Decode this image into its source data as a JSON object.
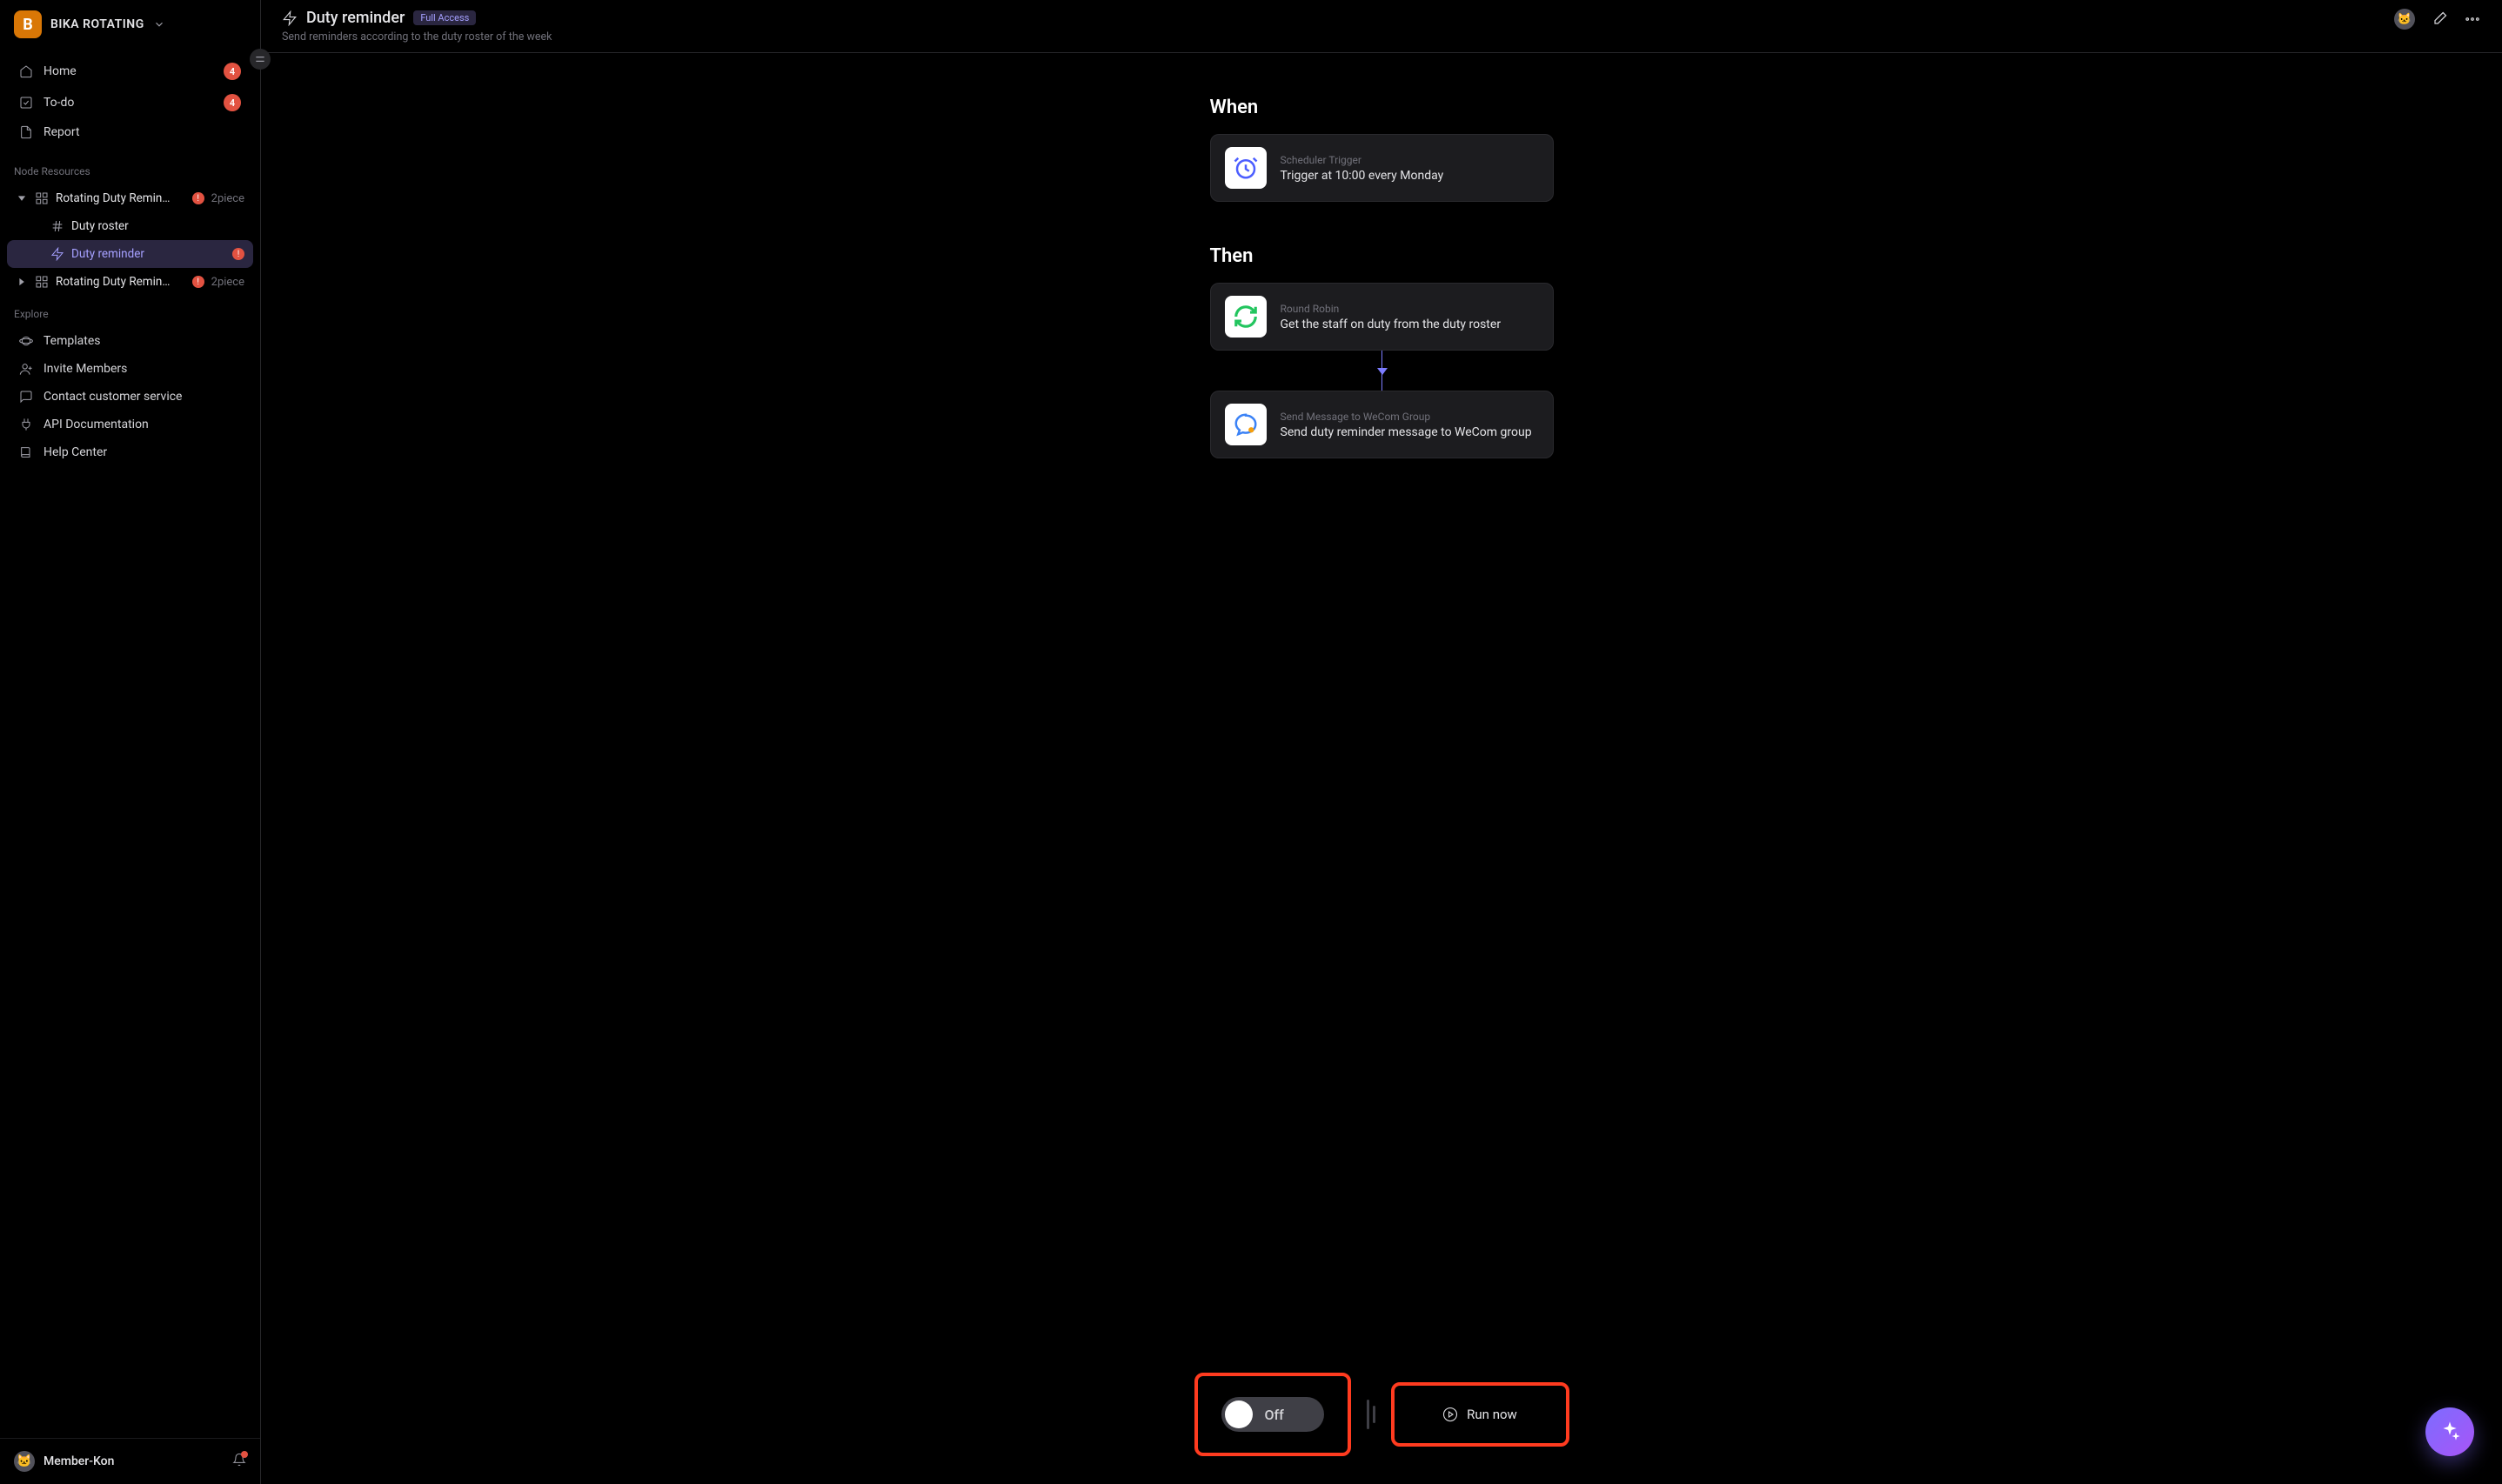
{
  "workspace": {
    "badge_letter": "B",
    "name": "BIKA ROTATING"
  },
  "nav": {
    "home": {
      "label": "Home",
      "count": "4"
    },
    "todo": {
      "label": "To-do",
      "count": "4"
    },
    "report": {
      "label": "Report"
    }
  },
  "sections": {
    "node_resources": "Node Resources",
    "explore": "Explore"
  },
  "tree": {
    "folder1": {
      "label": "Rotating Duty Remin…",
      "meta": "2piece"
    },
    "child_roster": {
      "label": "Duty roster"
    },
    "child_reminder": {
      "label": "Duty reminder"
    },
    "folder2": {
      "label": "Rotating Duty Remin…",
      "meta": "2piece"
    }
  },
  "explore": {
    "templates": "Templates",
    "invite": "Invite Members",
    "contact": "Contact customer service",
    "api": "API Documentation",
    "help": "Help Center"
  },
  "user": {
    "avatar_emoji": "🐱",
    "name": "Member-Kon"
  },
  "header": {
    "title": "Duty reminder",
    "access": "Full Access",
    "subtitle": "Send reminders according to the duty roster of the week"
  },
  "flow": {
    "when_heading": "When",
    "then_heading": "Then",
    "trigger": {
      "type": "Scheduler Trigger",
      "desc": "Trigger at 10:00 every Monday"
    },
    "step_round_robin": {
      "type": "Round Robin",
      "desc": "Get the staff on duty from the duty roster"
    },
    "step_wecom": {
      "type": "Send Message to WeCom Group",
      "desc": "Send duty reminder message to WeCom group"
    }
  },
  "controls": {
    "toggle_state": "Off",
    "run_now": "Run now"
  },
  "colors": {
    "accent": "#7c6cff",
    "warn": "#e25241",
    "highlight": "#ff3b1f"
  }
}
